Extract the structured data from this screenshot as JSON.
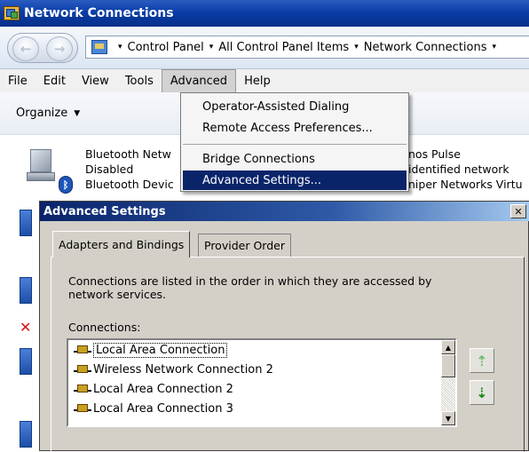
{
  "window": {
    "title": "Network Connections"
  },
  "address": {
    "crumbs": [
      "Control Panel",
      "All Control Panel Items",
      "Network Connections"
    ],
    "sep": "▾"
  },
  "menubar": {
    "items": [
      {
        "label": "File"
      },
      {
        "label": "Edit"
      },
      {
        "label": "View"
      },
      {
        "label": "Tools"
      },
      {
        "label": "Advanced"
      },
      {
        "label": "Help"
      }
    ]
  },
  "toolbar": {
    "organize_label": "Organize",
    "organize_arrow": "▼"
  },
  "connections": {
    "bluetooth": {
      "line1": "Bluetooth Netw",
      "line2": "Disabled",
      "line3": "Bluetooth Devic"
    },
    "pulse": {
      "line1": "nos Pulse",
      "line2": "identified network",
      "line3": "niper Networks Virtu"
    }
  },
  "advanced_menu": {
    "items": [
      {
        "label": "Operator-Assisted Dialing"
      },
      {
        "label": "Remote Access Preferences..."
      },
      {
        "label": "Bridge Connections"
      },
      {
        "label": "Advanced Settings..."
      }
    ],
    "highlighted": "Advanced Settings..."
  },
  "dialog": {
    "title": "Advanced Settings",
    "close_glyph": "✕",
    "tabs": [
      {
        "label": "Adapters and Bindings"
      },
      {
        "label": "Provider Order"
      }
    ],
    "description": "Connections are listed in the order in which they are accessed by network services.",
    "connections_label": "Connections:",
    "list": [
      {
        "label": "Local Area Connection"
      },
      {
        "label": "Wireless Network Connection 2"
      },
      {
        "label": "Local Area Connection 2"
      },
      {
        "label": "Local Area Connection 3"
      }
    ],
    "move_up_glyph": "⇡",
    "move_down_glyph": "⇣"
  }
}
